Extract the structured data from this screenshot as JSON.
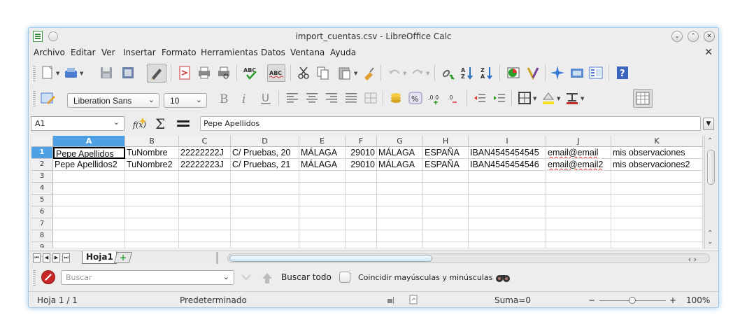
{
  "window": {
    "title": "import_cuentas.csv - LibreOffice Calc"
  },
  "menu": [
    "Archivo",
    "Editar",
    "Ver",
    "Insertar",
    "Formato",
    "Herramientas",
    "Datos",
    "Ventana",
    "Ayuda"
  ],
  "toolbar": {
    "font_name": "Liberation Sans",
    "font_size": "10",
    "abc_label": "ABC"
  },
  "formula_bar": {
    "cell_ref": "A1",
    "content": "Pepe Apellidos"
  },
  "grid": {
    "columns": [
      "A",
      "B",
      "C",
      "D",
      "E",
      "F",
      "G",
      "H",
      "I",
      "J",
      "K"
    ],
    "row_numbers": [
      "1",
      "2",
      "3",
      "4",
      "5",
      "6",
      "7",
      "8",
      "9"
    ],
    "rows": [
      [
        "Pepe Apellidos",
        "TuNombre",
        "22222222J",
        "C/ Pruebas, 20",
        "MÁLAGA",
        "29010",
        "MÁLAGA",
        "ESPAÑA",
        "IBAN4545454545",
        "email@email",
        "mis observaciones"
      ],
      [
        "Pepe Apellidos2",
        "TuNombre2",
        "22222223J",
        "C/ Pruebas, 21",
        "MÁLAGA",
        "29010",
        "MÁLAGA",
        "ESPAÑA",
        "IBAN4545454546",
        "email@email2",
        "mis observaciones2"
      ]
    ],
    "selected_cell": "A1"
  },
  "sheet_tabs": {
    "active": "Hoja1"
  },
  "find_bar": {
    "placeholder": "Buscar",
    "find_all": "Buscar todo",
    "match_case": "Coincidir mayúsculas y minúsculas"
  },
  "status": {
    "sheet": "Hoja 1 / 1",
    "style": "Predeterminado",
    "sum": "Suma=0",
    "zoom": "100%"
  },
  "colors": {
    "selection_header": "#4ea1e4",
    "window_glow": "#9ec9e9"
  }
}
